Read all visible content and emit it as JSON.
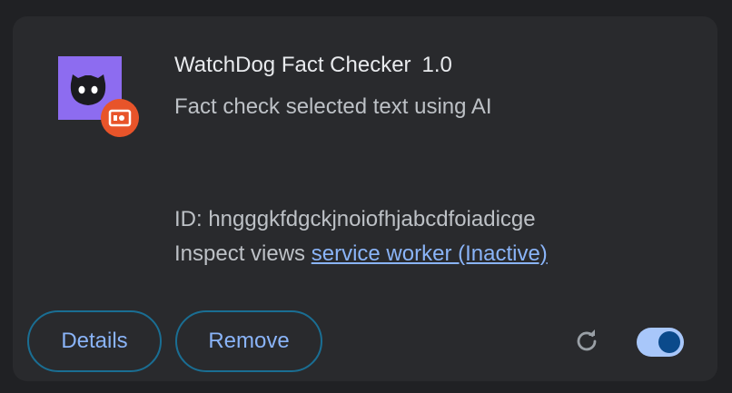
{
  "extension": {
    "name": "WatchDog Fact Checker",
    "version": "1.0",
    "description": "Fact check selected text using AI",
    "id_text": "ID: hngggkfdgckjnoiofhjabcdfoiadicge",
    "inspect_label": "Inspect views ",
    "inspect_link": "service worker (Inactive)",
    "icon": "cat-face-icon",
    "badge_icon": "unpacked-extension-badge-icon"
  },
  "actions": {
    "details_label": "Details",
    "remove_label": "Remove",
    "reload_icon": "reload-icon",
    "enabled": true
  },
  "colors": {
    "card_bg": "#292a2d",
    "page_bg": "#202124",
    "icon_bg": "#8d6cf0",
    "badge_bg": "#e8542a",
    "link": "#8ab4f8",
    "toggle_track": "#a8c7fa",
    "toggle_knob": "#0b4a8b"
  }
}
